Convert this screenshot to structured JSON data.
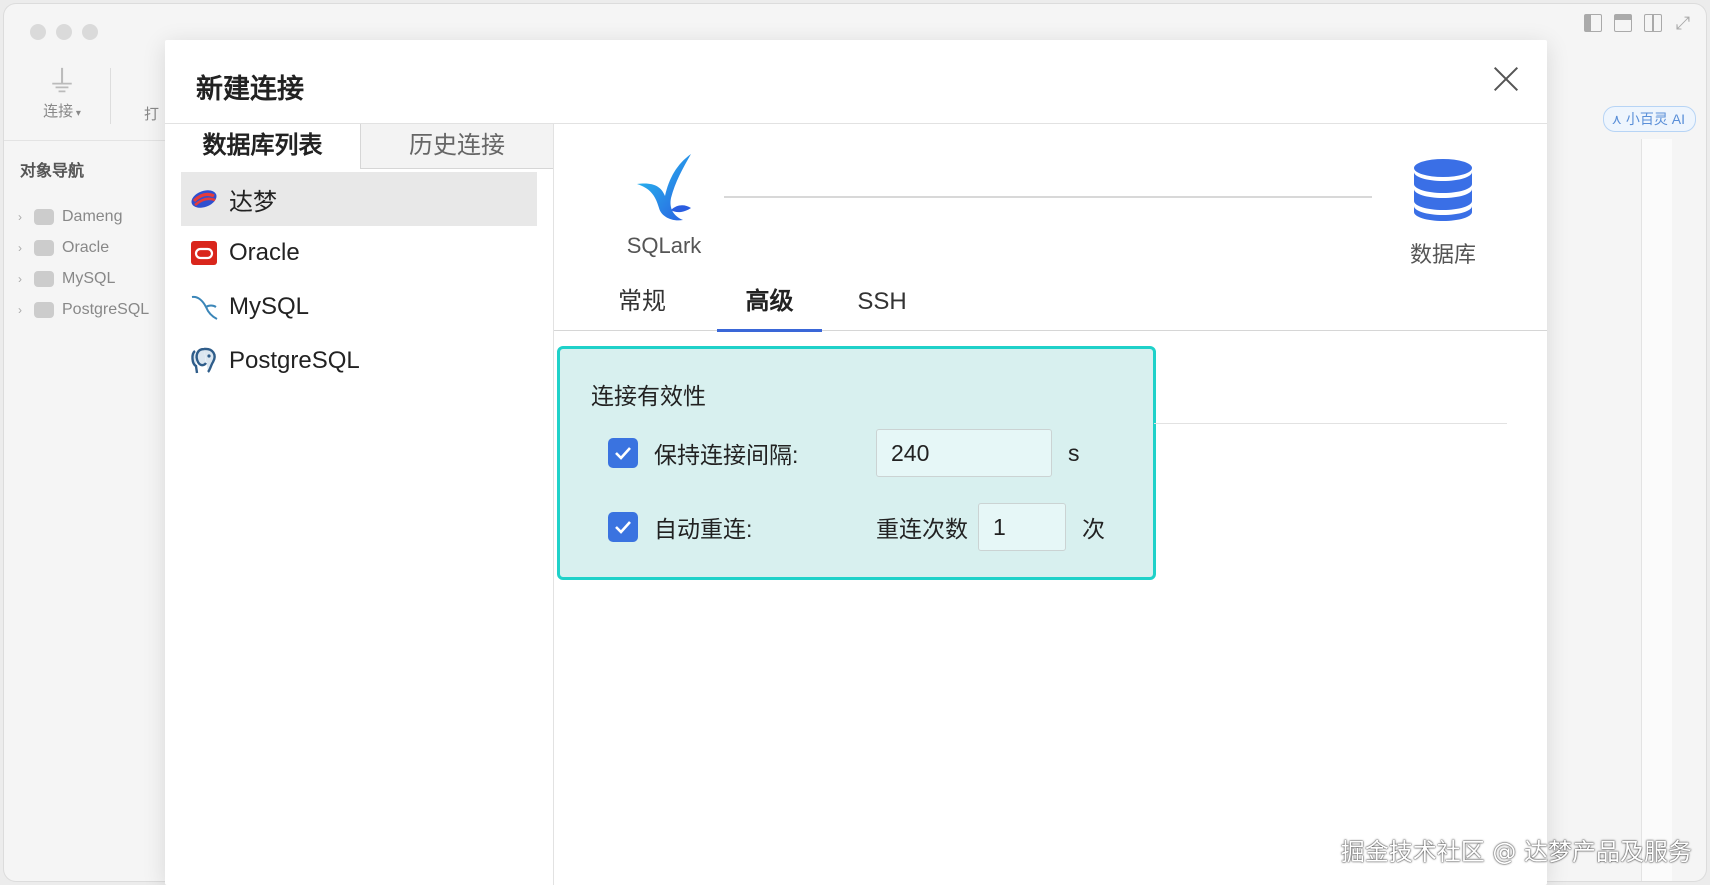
{
  "app": {
    "toolbar": {
      "connect_label": "连接",
      "open_label_partial": "打"
    },
    "ai_badge": "小百灵 AI",
    "nav": {
      "title": "对象导航",
      "items": [
        {
          "label": "Dameng",
          "icon": "dameng-icon"
        },
        {
          "label": "Oracle",
          "icon": "oracle-icon"
        },
        {
          "label": "MySQL",
          "icon": "mysql-icon"
        },
        {
          "label": "PostgreSQL",
          "icon": "postgresql-icon"
        }
      ]
    }
  },
  "dialog": {
    "title": "新建连接",
    "left_tabs": {
      "active": "数据库列表",
      "inactive": "历史连接"
    },
    "databases": [
      {
        "label": "达梦",
        "icon": "dameng-icon",
        "selected": true
      },
      {
        "label": "Oracle",
        "icon": "oracle-icon",
        "selected": false
      },
      {
        "label": "MySQL",
        "icon": "mysql-icon",
        "selected": false
      },
      {
        "label": "PostgreSQL",
        "icon": "postgresql-icon",
        "selected": false
      }
    ],
    "flow": {
      "source_label": "SQLark",
      "target_label": "数据库"
    },
    "tabs": [
      {
        "label": "常规",
        "active": false
      },
      {
        "label": "高级",
        "active": true
      },
      {
        "label": "SSH",
        "active": false
      }
    ],
    "section": {
      "title": "连接有效性",
      "keepalive": {
        "checked": true,
        "label": "保持连接间隔:",
        "value": "240",
        "unit": "s"
      },
      "auto_reconnect": {
        "checked": true,
        "label": "自动重连:",
        "retry_label": "重连次数",
        "value": "1",
        "unit": "次"
      }
    }
  },
  "colors": {
    "accent": "#3a73e0",
    "highlight_border": "#1fd1c9",
    "highlight_fill": "#d8f0ef",
    "tab_underline": "#3a67d8"
  },
  "watermark": "掘金技术社区 @ 达梦产品及服务"
}
